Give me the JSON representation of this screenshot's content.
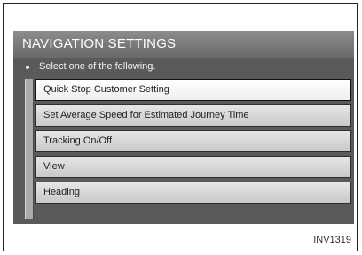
{
  "header": {
    "title": "NAVIGATION SETTINGS"
  },
  "subtitle": "Select one of the following.",
  "menu": {
    "items": [
      {
        "label": "Quick Stop Customer Setting"
      },
      {
        "label": "Set Average Speed for Estimated Journey Time"
      },
      {
        "label": "Tracking On/Off"
      },
      {
        "label": "View"
      },
      {
        "label": "Heading"
      }
    ]
  },
  "figure_code": "INV1319",
  "colors": {
    "screen_bg": "#5a5a5a",
    "title_bar": "#7a7a7a",
    "menu_item": "#d4d4d4",
    "highlight": "#ffffff"
  }
}
